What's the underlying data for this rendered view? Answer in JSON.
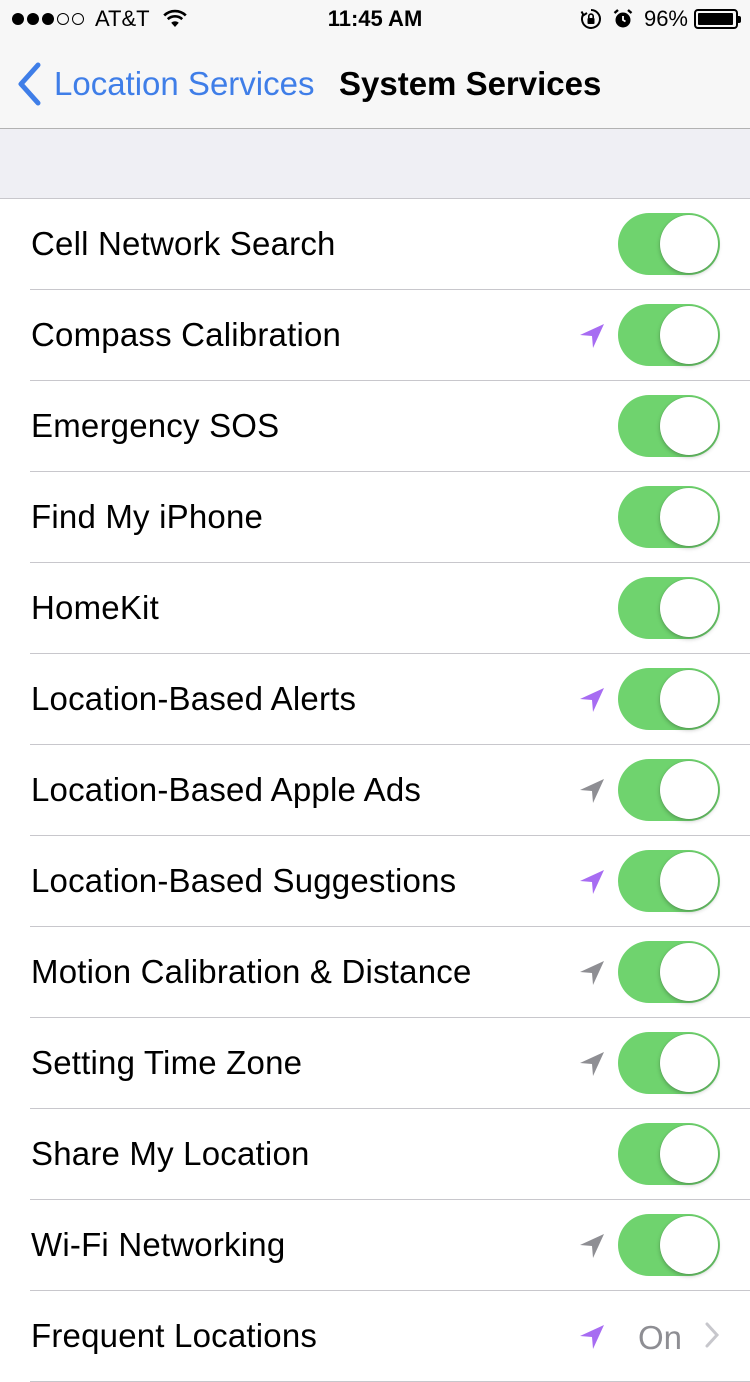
{
  "status_bar": {
    "carrier": "AT&T",
    "signal_bars": 3,
    "signal_total": 5,
    "time": "11:45 AM",
    "battery_percent": "96%",
    "icons": [
      "wifi-icon",
      "orientation-lock-icon",
      "alarm-icon",
      "battery-icon"
    ]
  },
  "nav": {
    "back_label": "Location Services",
    "title": "System Services"
  },
  "colors": {
    "accent": "#3f7ee8",
    "toggle_on": "#6fd36e",
    "location_recent": "#a76cf2",
    "location_past": "#8e8e93"
  },
  "rows": [
    {
      "label": "Cell Network Search",
      "toggle": true,
      "location_icon": null
    },
    {
      "label": "Compass Calibration",
      "toggle": true,
      "location_icon": "purple"
    },
    {
      "label": "Emergency SOS",
      "toggle": true,
      "location_icon": null
    },
    {
      "label": "Find My iPhone",
      "toggle": true,
      "location_icon": null
    },
    {
      "label": "HomeKit",
      "toggle": true,
      "location_icon": null
    },
    {
      "label": "Location-Based Alerts",
      "toggle": true,
      "location_icon": "purple"
    },
    {
      "label": "Location-Based Apple Ads",
      "toggle": true,
      "location_icon": "gray"
    },
    {
      "label": "Location-Based Suggestions",
      "toggle": true,
      "location_icon": "purple"
    },
    {
      "label": "Motion Calibration & Distance",
      "toggle": true,
      "location_icon": "gray"
    },
    {
      "label": "Setting Time Zone",
      "toggle": true,
      "location_icon": "gray"
    },
    {
      "label": "Share My Location",
      "toggle": true,
      "location_icon": null
    },
    {
      "label": "Wi-Fi Networking",
      "toggle": true,
      "location_icon": "gray"
    },
    {
      "label": "Frequent Locations",
      "toggle": null,
      "location_icon": "purple",
      "value": "On",
      "disclosure": true
    }
  ]
}
